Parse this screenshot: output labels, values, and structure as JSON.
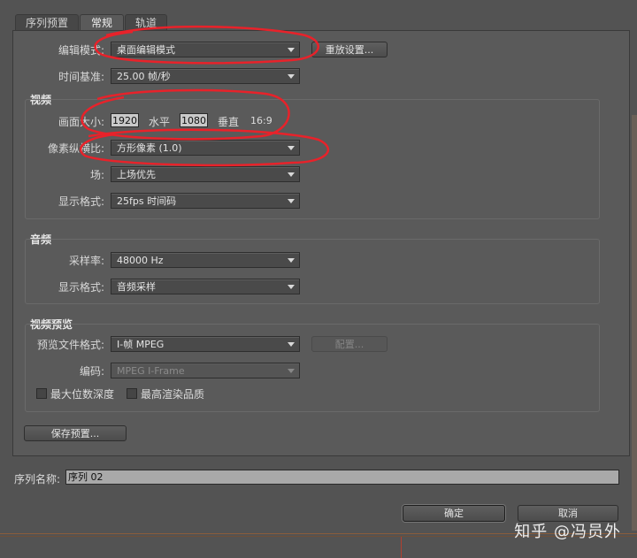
{
  "tabs": [
    "序列预置",
    "常规",
    "轨道"
  ],
  "general": {
    "edit_mode_label": "编辑模式:",
    "edit_mode_value": "桌面编辑模式",
    "reset_button": "重放设置...",
    "timebase_label": "时间基准:",
    "timebase_value": "25.00 帧/秒"
  },
  "video": {
    "title": "视频",
    "frame_size_label": "画面大小:",
    "width": "1920",
    "horizontal": "水平",
    "height": "1080",
    "vertical": "垂直",
    "aspect": "16:9",
    "pixel_aspect_label": "像素纵横比:",
    "pixel_aspect_value": "方形像素 (1.0)",
    "field_label": "场:",
    "field_value": "上场优先",
    "display_format_label": "显示格式:",
    "display_format_value": "25fps 时间码"
  },
  "audio": {
    "title": "音频",
    "sample_rate_label": "采样率:",
    "sample_rate_value": "48000 Hz",
    "display_format_label": "显示格式:",
    "display_format_value": "音频采样"
  },
  "preview": {
    "title": "视频预览",
    "file_format_label": "预览文件格式:",
    "file_format_value": "I-帧 MPEG",
    "config_button": "配置...",
    "codec_label": "编码:",
    "codec_value": "MPEG I-Frame",
    "max_bit_depth": "最大位数深度",
    "max_render_quality": "最高渲染品质"
  },
  "save_preset_button": "保存预置...",
  "sequence_name_label": "序列名称:",
  "sequence_name_value": "序列 02",
  "ok_button": "确定",
  "cancel_button": "取消",
  "watermark": "知乎 @冯员外",
  "colors": {
    "background": "#535353",
    "annotation": "#e8222a"
  }
}
